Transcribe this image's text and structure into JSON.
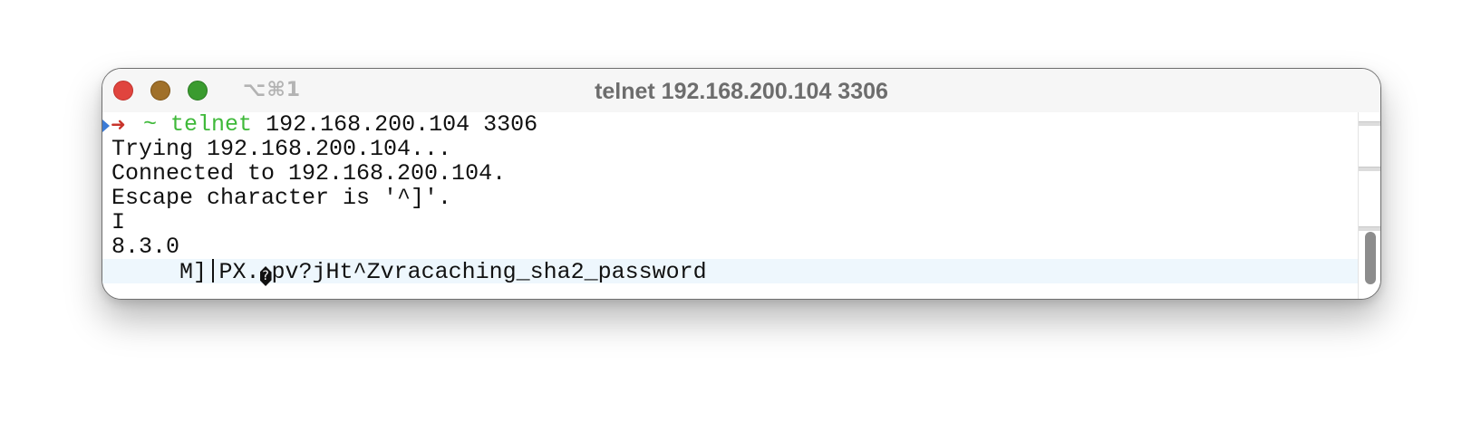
{
  "window": {
    "title": "telnet 192.168.200.104 3306",
    "shortcut": "⌥⌘1"
  },
  "colors": {
    "close": "#e0443e",
    "minimize": "#a0702a",
    "zoom": "#3a9b2f",
    "prompt_arrow": "#c8342b",
    "prompt_green": "#3fb93a",
    "current_line_bg": "#eef7fd"
  },
  "terminal": {
    "prompt": {
      "arrow": "➜",
      "tilde": "~",
      "command": "telnet",
      "args": "192.168.200.104 3306"
    },
    "lines": [
      "Trying 192.168.200.104...",
      "Connected to 192.168.200.104.",
      "Escape character is '^]'.",
      "I",
      "8.3.0"
    ],
    "last_line": {
      "part1": "     M]",
      "part2": "PX.",
      "part3": "pv?jHt^Zvracaching_sha2_password"
    }
  },
  "icons": {
    "close": "close-icon",
    "minimize": "minimize-icon",
    "zoom": "zoom-icon",
    "mark": "mark-icon",
    "replacement_char": "replacement-char-icon"
  }
}
